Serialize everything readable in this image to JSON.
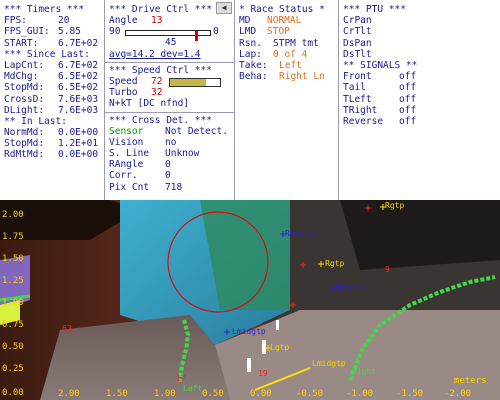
{
  "timers": {
    "header": "*** Timers ***",
    "rows": [
      {
        "k": "FPS:",
        "v": "20"
      },
      {
        "k": "FPS_GUI:",
        "v": "5.85"
      },
      {
        "k": "START:",
        "v": "6.7E+02"
      }
    ],
    "since_hdr": "*** Since Last:",
    "since": [
      {
        "k": "LapCnt:",
        "v": "6.7E+02"
      },
      {
        "k": "MdChg:",
        "v": "6.5E+02"
      },
      {
        "k": "StopMd:",
        "v": "6.5E+02"
      },
      {
        "k": "CrossD:",
        "v": "7.6E+03"
      },
      {
        "k": "DLight:",
        "v": "7.6E+03"
      }
    ],
    "inlast_hdr": "** In Last:",
    "inlast": [
      {
        "k": "NormMd:",
        "v": "0.0E+00"
      },
      {
        "k": "StopMd:",
        "v": "1.2E+01"
      },
      {
        "k": "RdMtMd:",
        "v": "0.0E+00"
      }
    ]
  },
  "drive": {
    "header": "*** Drive Ctrl ***",
    "scroll_arrow": "◀",
    "angle_label": "Angle",
    "angle_value": "13",
    "slider_min": "90",
    "slider_max": "0",
    "slider_value_fraction": 0.85,
    "slider_center": "45",
    "avg_line": "avg=14.2  dev=1.4",
    "speed_hdr": "*** Speed Ctrl ***",
    "speed_label": "Speed",
    "speed_value": "72",
    "speed_fill": 0.72,
    "turbo_label": "Turbo",
    "turbo_value": "32",
    "nkt_line": "N+kT [DC nfnd]",
    "cross_hdr": "*** Cross Det. ***",
    "cross_rows": [
      {
        "k": "Sensor",
        "v": "Not Detect.",
        "kclass": "green"
      },
      {
        "k": "Vision",
        "v": "no"
      },
      {
        "k": "S. Line",
        "v": "Unknow"
      },
      {
        "k": "RAngle",
        "v": "0"
      },
      {
        "k": "Corr.",
        "v": "0"
      },
      {
        "k": "Pix Cnt",
        "v": "718"
      }
    ]
  },
  "race": {
    "header": "* Race Status *",
    "md_label": "MD",
    "md_value": "NORMAL",
    "lmd_label": "LMD",
    "lmd_value": "STOP",
    "rsn_label": "Rsn.",
    "rsn_value": "STPM tmt",
    "lap_label": "Lap:",
    "lap_value": "0 of 4",
    "take_label": "Take:",
    "take_value": "Left",
    "beha_label": "Beha:",
    "beha_value": "Right Ln"
  },
  "ptu": {
    "header": "*** PTU ***",
    "items": [
      "CrPan",
      "CrTlt",
      "DsPan",
      "DsTlt"
    ],
    "signals_hdr": "** SIGNALS **",
    "signals": [
      {
        "k": "Front",
        "v": "off"
      },
      {
        "k": "Tail",
        "v": "off"
      },
      {
        "k": "TLeft",
        "v": "off"
      },
      {
        "k": "TRight",
        "v": "off"
      },
      {
        "k": "Reverse",
        "v": "off"
      }
    ]
  },
  "camera": {
    "left_ticks": [
      "2.00",
      "1.75",
      "1.50",
      "1.25",
      "1.00",
      "0.75",
      "0.50",
      "0.25",
      "0.00"
    ],
    "bottom_ticks": [
      "2.00",
      "1.50",
      "1.00",
      "0.50",
      "0.00",
      "-0.50",
      "-1.00",
      "-1.50",
      "-2.00"
    ],
    "units": "meters",
    "labels": {
      "rgtp_top": "Rgtp",
      "rmidgtp": "Rmidgtp",
      "rgtp": "Rgtp",
      "rmidgtp2": "Rmidgtp",
      "lmidgtp": "Lmidgtp",
      "lgtp": "Lgtp",
      "lmidgtp_low": "Lmidgtp",
      "left": "Left",
      "right": "Right",
      "n63": "63",
      "n19": "19",
      "n17": "17",
      "n9": "9"
    },
    "colors": {
      "accent_blue": "#1a1a90",
      "lane_green": "#3fd84a",
      "marker_red": "#ff2020",
      "tick_yellow": "#ffd400"
    }
  }
}
